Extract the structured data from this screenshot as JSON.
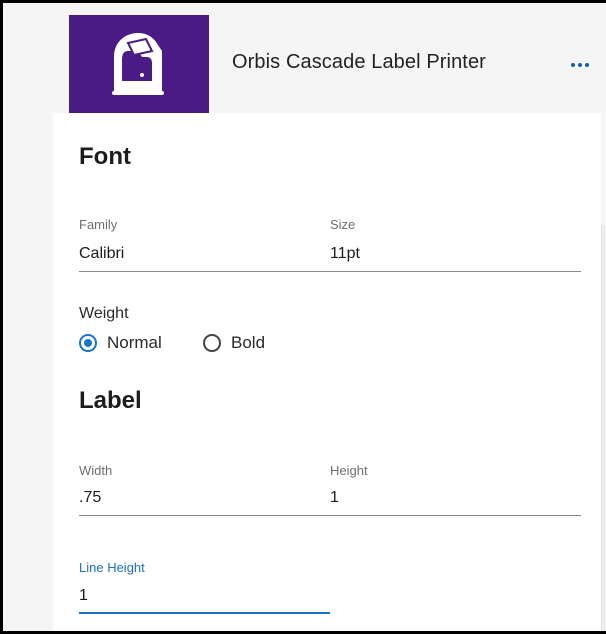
{
  "header": {
    "title": "Orbis Cascade Label Printer",
    "icon": "label-printer-icon",
    "more_icon": "more-horizontal-icon",
    "brand_color": "#4a1a85"
  },
  "font_section": {
    "title": "Font",
    "family_label": "Family",
    "family_value": "Calibri",
    "size_label": "Size",
    "size_value": "11pt",
    "weight_label": "Weight",
    "weight_options": [
      {
        "label": "Normal",
        "checked": true
      },
      {
        "label": "Bold",
        "checked": false
      }
    ]
  },
  "label_section": {
    "title": "Label",
    "width_label": "Width",
    "width_value": ".75",
    "height_label": "Height",
    "height_value": "1",
    "line_height_label": "Line Height",
    "line_height_value": "1"
  },
  "colors": {
    "accent": "#1a73c9"
  }
}
